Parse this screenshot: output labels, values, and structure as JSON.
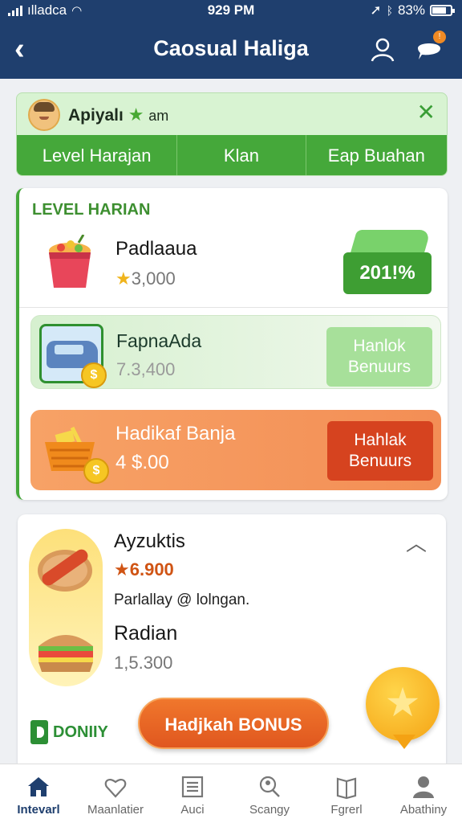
{
  "status_bar": {
    "carrier": "ılladca",
    "time": "929 PM",
    "battery": "83%"
  },
  "header": {
    "title": "Caosual Haliga",
    "back_icon": "chevron-left-icon",
    "user_icon": "user-icon",
    "chat_icon": "chat-bubble-icon",
    "chat_badge": "!"
  },
  "notice": {
    "name": "Apiyalı",
    "suffix": "am",
    "star_icon": "star-icon",
    "tabs": [
      "Level Harajan",
      "Klan",
      "Eap Buahan"
    ]
  },
  "level_card": {
    "header": "LEVEL HARIAN",
    "item1": {
      "name": "Padlaaua",
      "value": "3,000",
      "percent": "201!%"
    },
    "item2": {
      "name": "FapnaAda",
      "value": "7.3,400",
      "button": [
        "Hanlok",
        "Benuurs"
      ]
    },
    "item3": {
      "name": "Hadikaf Banja",
      "value": "4 $.00",
      "button": [
        "Hahlak",
        "Benuurs"
      ]
    }
  },
  "food_card": {
    "item1": {
      "name": "Ayzuktis",
      "price": "6.900",
      "desc": "Parlallay @ lolngan."
    },
    "item2": {
      "name": "Radian",
      "value": "1,5.300"
    },
    "brand": "DONIIY"
  },
  "cta_label": "Hadjkah BONUS",
  "colors": {
    "primary": "#1f3f6e",
    "green": "#45a83a",
    "orange": "#f38e55"
  },
  "bottom_nav": [
    {
      "label": "Intevarl",
      "icon": "home-icon"
    },
    {
      "label": "Maanlatier",
      "icon": "heart-icon"
    },
    {
      "label": "Auci",
      "icon": "list-icon"
    },
    {
      "label": "Scangy",
      "icon": "search-person-icon"
    },
    {
      "label": "Fgrerl",
      "icon": "book-icon"
    },
    {
      "label": "Abathiny",
      "icon": "person-icon"
    }
  ]
}
